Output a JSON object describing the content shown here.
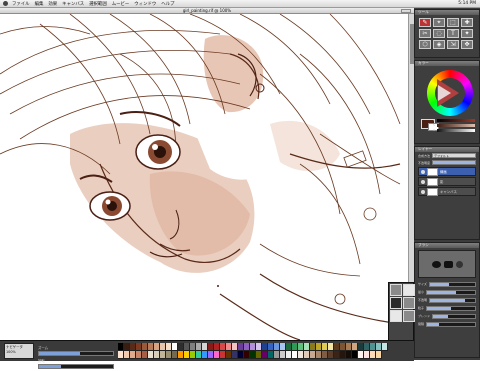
{
  "menubar": {
    "items": [
      "ファイル",
      "編集",
      "効果",
      "キャンバス",
      "選択範囲",
      "ムービー",
      "ウィンドウ",
      "ヘルプ"
    ],
    "clock": "5:14 PM"
  },
  "document": {
    "title": "girl_painting.rif @ 100%"
  },
  "tools_panel": {
    "title": "ツール",
    "tools": [
      "✎",
      "⌖",
      "⬚",
      "✚",
      "✂",
      "◌",
      "T",
      "✦",
      "⬡",
      "◈",
      "⇲",
      "✥"
    ]
  },
  "color_panel": {
    "title": "カラー",
    "main_color": "#4a1f14",
    "sub_color": "#ffffff",
    "row_labels": [
      "H",
      "S",
      "V"
    ]
  },
  "layer_panel": {
    "title": "レイヤー",
    "composite_label": "合成方法",
    "composite_value": "デフォルト",
    "opacity_label": "不透明度",
    "layers": [
      {
        "name": "線画"
      },
      {
        "name": "影"
      },
      {
        "name": "キャンバス"
      }
    ]
  },
  "brush_panel": {
    "title": "ブラシ",
    "params": [
      {
        "label": "サイズ",
        "value": 0.42
      },
      {
        "label": "最小",
        "value": 0.6
      },
      {
        "label": "不透明",
        "value": 0.78
      },
      {
        "label": "粒子",
        "value": 0.5
      },
      {
        "label": "ブレンド",
        "value": 0.35
      },
      {
        "label": "間隔",
        "value": 0.25
      }
    ]
  },
  "status": {
    "nav_lines": [
      "ナビゲータ",
      "100%",
      "拡大"
    ],
    "zoom_label": "ズーム",
    "zoom_value": 0.55,
    "rotate_label": "回転",
    "rotate_value": 0.3
  },
  "palette_colors": [
    "#000000",
    "#3a1d12",
    "#5b2a17",
    "#7a3b22",
    "#9a5a3a",
    "#b97a58",
    "#d6a383",
    "#e8c4aa",
    "#f4ddc9",
    "#ffffff",
    "#2d2d2d",
    "#555555",
    "#808080",
    "#aaaaaa",
    "#d4d4d4",
    "#8b1a1a",
    "#b22222",
    "#d94848",
    "#ef8a8a",
    "#f6c1c1",
    "#6a3d9a",
    "#8e5fc0",
    "#b08fd8",
    "#d4c2ee",
    "#1f3f8f",
    "#3465c4",
    "#6a96e0",
    "#a9c4f0",
    "#1d6b3a",
    "#2f9a55",
    "#5fc07d",
    "#a6e0b6",
    "#8a7a1a",
    "#bfa62a",
    "#e0cc55",
    "#f2e6a2",
    "#5a3a1a",
    "#7e5430",
    "#a87a52",
    "#cfa47e",
    "#193b3b",
    "#2e6464",
    "#4f9494",
    "#85c2c2",
    "#c6e6e6",
    "#ffe3d0",
    "#f3c9b0",
    "#e3a98c",
    "#c98468",
    "#a65e44",
    "#e8e0d0",
    "#d8cfba",
    "#c0b598",
    "#9a8e70",
    "#746a50",
    "#ff9900",
    "#ffcc00",
    "#99cc00",
    "#33cc99",
    "#3399ff",
    "#9966ff",
    "#ff66cc",
    "#cc3333",
    "#663300",
    "#333366",
    "#000033",
    "#330000",
    "#003300",
    "#666600",
    "#660066",
    "#006666",
    "#999999",
    "#cccccc",
    "#eeeeee",
    "#ffffff",
    "#f0e6dc",
    "#e0cbb8",
    "#c8a890",
    "#a88468",
    "#805c44",
    "#5a3c28",
    "#3a2418",
    "#24160e",
    "#140c06",
    "#000000",
    "#fff5ee",
    "#ffe4e1",
    "#ffdab9",
    "#fad6a5"
  ],
  "icons": {
    "apple": "apple-menu-icon",
    "eye": "visibility-eye-icon",
    "swap": "swap-colors-icon"
  }
}
